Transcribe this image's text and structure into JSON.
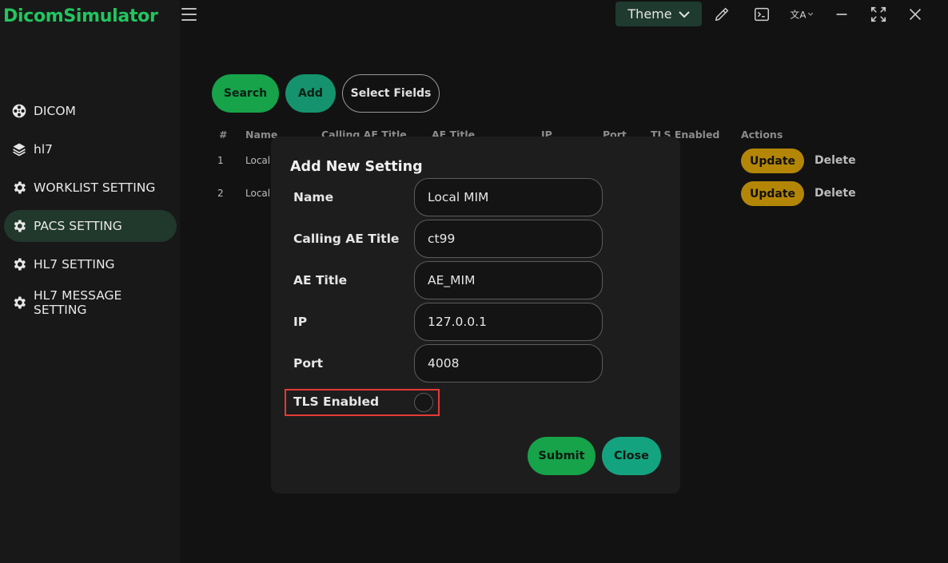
{
  "app": {
    "title": "DicomSimulator"
  },
  "sidebar": {
    "items": [
      {
        "label": "DICOM",
        "icon": "film-reel-icon"
      },
      {
        "label": "hl7",
        "icon": "layers-icon"
      },
      {
        "label": "WORKLIST SETTING",
        "icon": "gear-icon"
      },
      {
        "label": "PACS SETTING",
        "icon": "gear-icon",
        "active": true
      },
      {
        "label": "HL7 SETTING",
        "icon": "gear-icon"
      },
      {
        "label": "HL7 MESSAGE SETTING",
        "icon": "gear-icon"
      }
    ]
  },
  "topbar": {
    "theme_label": "Theme",
    "icons": [
      "menu-icon",
      "eyedropper-icon",
      "terminal-icon",
      "translate-icon",
      "minimize-icon",
      "maximize-icon",
      "close-icon"
    ]
  },
  "toolbar": {
    "search_label": "Search",
    "add_label": "Add",
    "select_fields_label": "Select Fields"
  },
  "table": {
    "headers": [
      "#",
      "Name",
      "Calling AE Title",
      "AE Title",
      "IP",
      "Port",
      "TLS Enabled",
      "Actions"
    ],
    "rows": [
      {
        "index": "1",
        "name": "Local"
      },
      {
        "index": "2",
        "name": "Local"
      }
    ],
    "update_label": "Update",
    "delete_label": "Delete"
  },
  "modal": {
    "title": "Add New Setting",
    "fields": [
      {
        "label": "Name",
        "value": "Local MIM"
      },
      {
        "label": "Calling AE Title",
        "value": "ct99"
      },
      {
        "label": "AE Title",
        "value": "AE_MIM"
      },
      {
        "label": "IP",
        "value": "127.0.0.1"
      },
      {
        "label": "Port",
        "value": "4008"
      }
    ],
    "tls_label": "TLS Enabled",
    "tls_checked": false,
    "submit_label": "Submit",
    "close_label": "Close"
  },
  "colors": {
    "brand": "#22c55e",
    "primary": "#16a34a",
    "teal": "#15936e",
    "warning": "#b38607",
    "highlight": "#e53935"
  }
}
